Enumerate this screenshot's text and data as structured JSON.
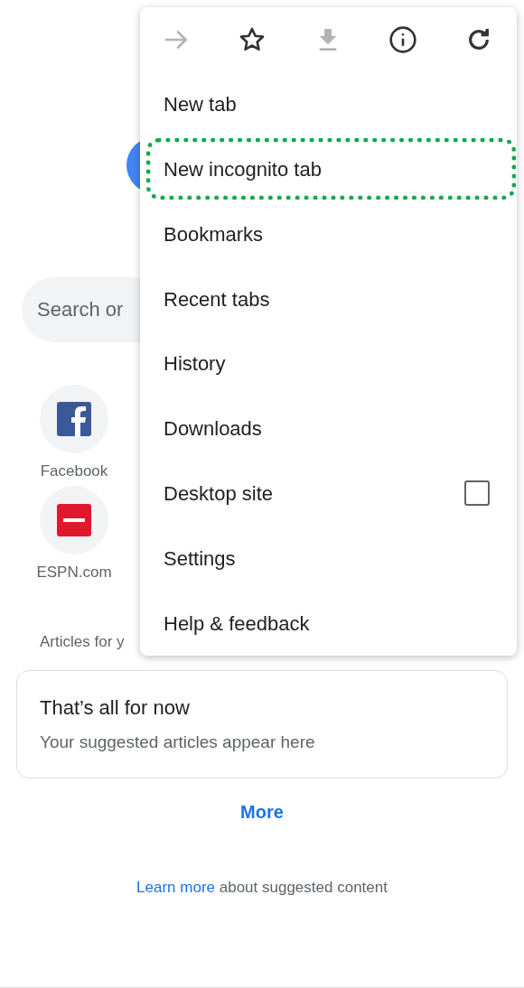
{
  "new_tab_page": {
    "search": {
      "placeholder": "Search or"
    },
    "shortcuts": [
      {
        "label": "Facebook",
        "kind": "facebook"
      },
      {
        "label": "ESPN.com",
        "kind": "espn"
      }
    ],
    "articles_heading": "Articles for y",
    "card": {
      "title": "That’s all for now",
      "subtitle": "Your suggested articles appear here"
    },
    "more_button": "More",
    "footer": {
      "link": "Learn more",
      "text": "about suggested content"
    }
  },
  "menu": {
    "toolbar": [
      {
        "kind": "forward",
        "disabled": true
      },
      {
        "kind": "star",
        "disabled": false
      },
      {
        "kind": "download",
        "disabled": true
      },
      {
        "kind": "info",
        "disabled": false
      },
      {
        "kind": "reload",
        "disabled": false
      }
    ],
    "items": [
      {
        "label": "New tab",
        "kind": "plain",
        "highlighted": false
      },
      {
        "label": "New incognito tab",
        "kind": "plain",
        "highlighted": true
      },
      {
        "label": "Bookmarks",
        "kind": "plain",
        "highlighted": false
      },
      {
        "label": "Recent tabs",
        "kind": "plain",
        "highlighted": false
      },
      {
        "label": "History",
        "kind": "plain",
        "highlighted": false
      },
      {
        "label": "Downloads",
        "kind": "plain",
        "highlighted": false
      },
      {
        "label": "Desktop site",
        "kind": "checkbox",
        "checked": false,
        "highlighted": false
      },
      {
        "label": "Settings",
        "kind": "plain",
        "highlighted": false
      },
      {
        "label": "Help & feedback",
        "kind": "plain",
        "highlighted": false
      }
    ]
  }
}
